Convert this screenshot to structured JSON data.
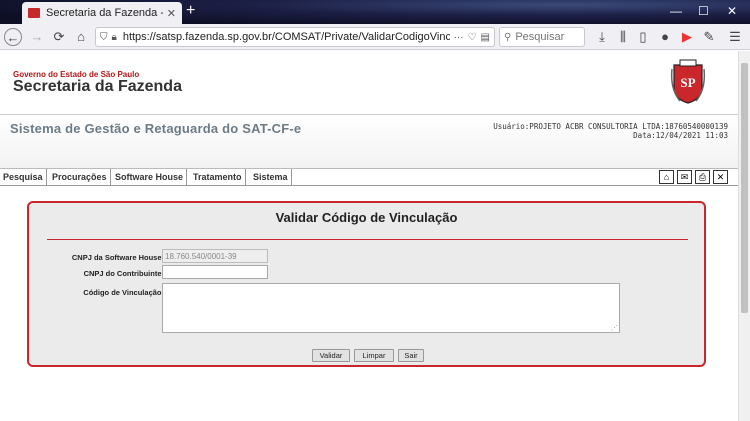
{
  "browser": {
    "tab_title": "Secretaria da Fazenda - Governo do",
    "tab_close": "✕",
    "new_tab": "+",
    "url": "https://satsp.fazenda.sp.gov.br/COMSAT/Private/ValidarCodigoVinculacao",
    "search_placeholder": "Pesquisar",
    "window_controls": {
      "minimize": "—",
      "maximize": "☐",
      "close": "✕"
    }
  },
  "header": {
    "gov_label": "Governo do Estado de São Paulo",
    "sec_label": "Secretaria da Fazenda",
    "brasao_letters": "SP"
  },
  "sysbar": {
    "title": "Sistema de Gestão e Retaguarda do SAT-CF-e",
    "user_line": "Usuário:PROJETO ACBR CONSULTORIA LTDA:18760540000139",
    "date_line": "Data:12/04/2021 11:03"
  },
  "menu": {
    "items": [
      "Pesquisa",
      "Procurações",
      "Software House",
      "Tratamento",
      "Sistema"
    ]
  },
  "form": {
    "title": "Validar Código de Vinculação",
    "cnpj_sh_label": "CNPJ da Software House:",
    "cnpj_sh_value": "18.760.540/0001-39",
    "cnpj_contrib_label": "CNPJ do Contribuinte:",
    "cnpj_contrib_value": "",
    "codigo_label": "Código de Vinculação:",
    "codigo_value": "",
    "btn_validar": "Validar",
    "btn_limpar": "Limpar",
    "btn_sair": "Sair"
  }
}
